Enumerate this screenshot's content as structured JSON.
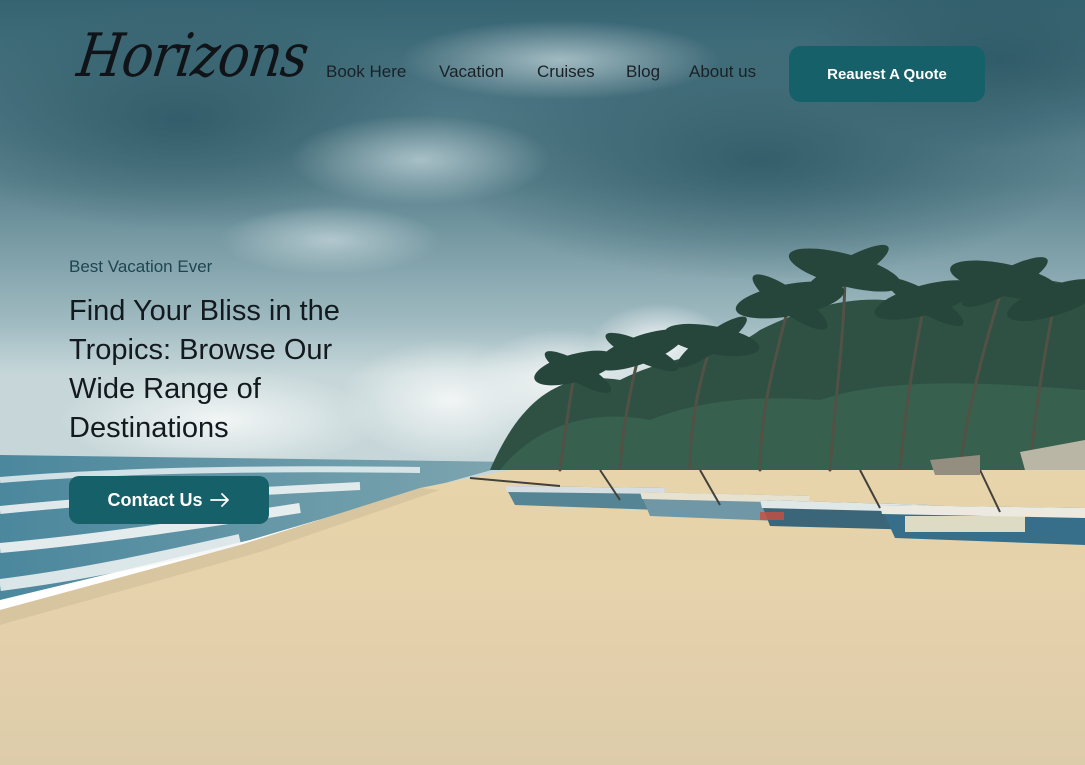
{
  "brand": {
    "logo_text": "Horizons"
  },
  "nav": {
    "items": [
      {
        "label": "Book Here"
      },
      {
        "label": "Vacation"
      },
      {
        "label": "Cruises"
      },
      {
        "label": "Blog"
      },
      {
        "label": "About us"
      }
    ],
    "cta_label": "Reauest A Quote"
  },
  "hero": {
    "eyebrow": "Best Vacation Ever",
    "title": "Find Your Bliss in the Tropics: Browse Our Wide Range of Destinations",
    "cta_label": "Contact Us",
    "cta_icon": "arrow-right-icon"
  },
  "theme": {
    "accent": "#16606a",
    "text_dark": "#131a1f",
    "eyebrow_color": "#1d4651",
    "sky": "#4d7a86",
    "sand": "#e6d3ab",
    "sea": "#3f7d93"
  },
  "background": {
    "subject": "Tropical beach with palm trees and fishing boats under a cloudy sky"
  }
}
